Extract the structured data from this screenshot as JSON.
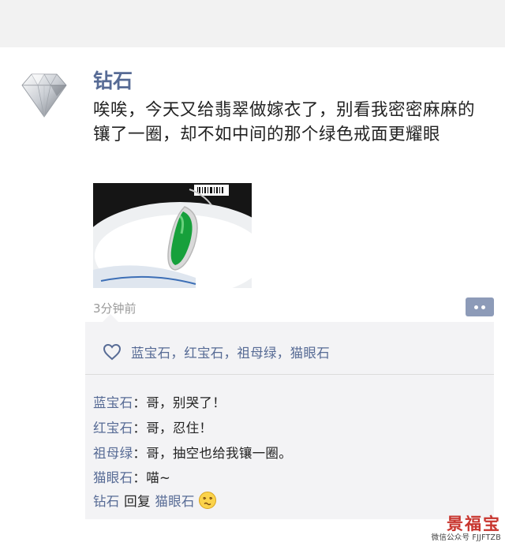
{
  "post": {
    "author": "钻石",
    "content": "唉唉，今天又给翡翠做嫁衣了，别看我密密麻麻的镶了一圈，却不如中间的那个绿色戒面更耀眼",
    "time": "3分钟前",
    "avatar_icon": "diamond-icon",
    "photo_icon": "jade-pendant-photo"
  },
  "likes": {
    "icon": "heart-outline-icon",
    "names": "蓝宝石，红宝石，祖母绿，猫眼石"
  },
  "comments": [
    {
      "author": "蓝宝石",
      "separator": "：",
      "text": "哥，别哭了！"
    },
    {
      "author": "红宝石",
      "separator": "：",
      "text": "哥，忍住！"
    },
    {
      "author": "祖母绿",
      "separator": "：",
      "text": "哥，抽空也给我镶一圈。"
    },
    {
      "author": "猫眼石",
      "separator": "：",
      "text": "喵~"
    }
  ],
  "reply": {
    "author": "钻石",
    "verb": " 回复 ",
    "target": "猫眼石",
    "emoji_icon": "dizzy-face-emoji-icon"
  },
  "watermark": {
    "title": "景福宝",
    "subtitle": "微信公众号 FJJFTZB"
  },
  "colors": {
    "name_link": "#576b95",
    "text": "#222222",
    "time": "#9a9a9a",
    "comment_bg": "#f3f3f5",
    "more_button": "#8d9bb8",
    "watermark_red": "#c8352e"
  }
}
